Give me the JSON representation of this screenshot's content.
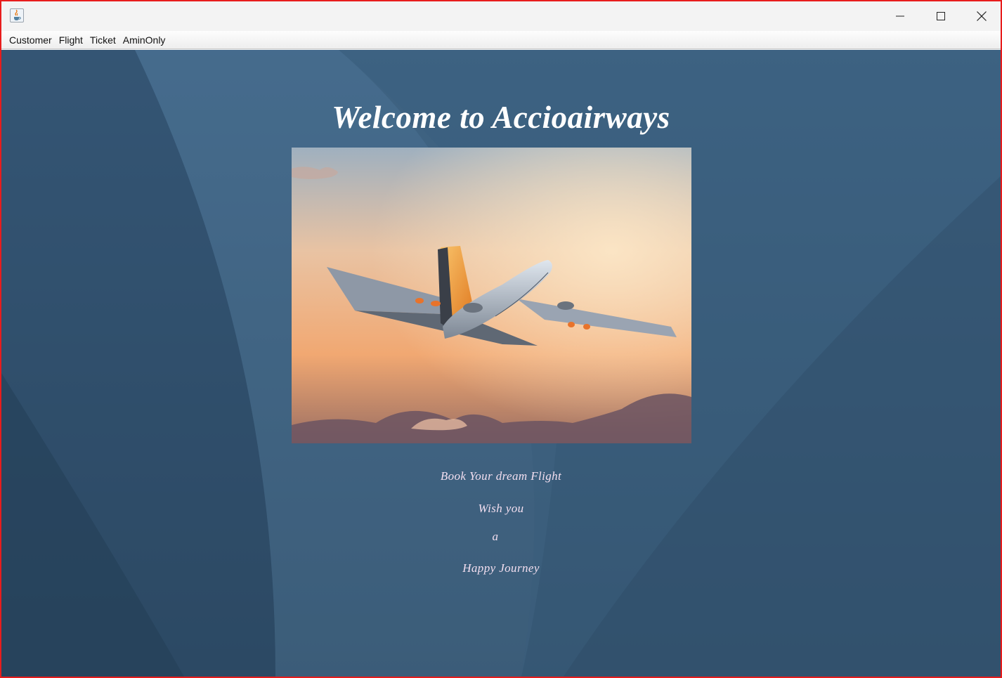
{
  "window": {
    "app_icon": "java-cup-icon",
    "controls": [
      "minimize-icon",
      "maximize-icon",
      "close-icon"
    ]
  },
  "menu": {
    "items": [
      "Customer",
      "Flight",
      "Ticket",
      "AminOnly"
    ]
  },
  "main": {
    "heading": "Welcome to Accioairways",
    "image_icon": "airplane-sunset-photo",
    "lines": [
      "Book Your dream Flight",
      "Wish you",
      "a",
      "Happy Journey"
    ]
  },
  "colors": {
    "background": "#3b5e7d",
    "heading": "#ffffff",
    "caption": "#f3dff0",
    "window_border": "#e81c1c"
  }
}
